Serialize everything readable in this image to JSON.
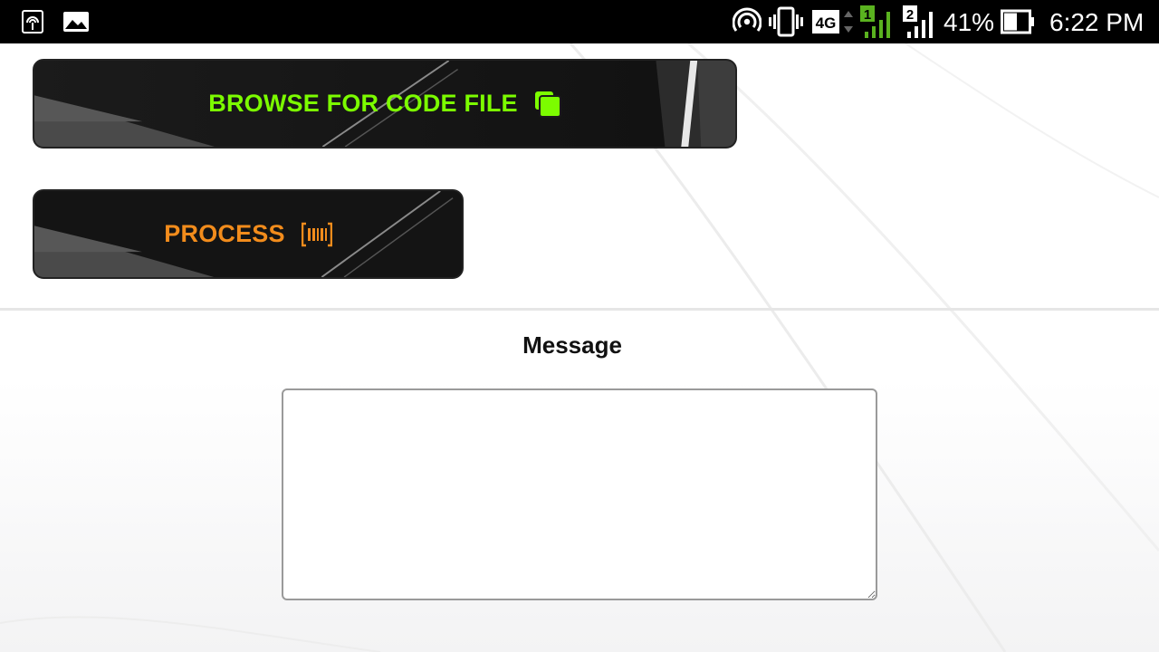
{
  "status_bar": {
    "battery_percent": "41%",
    "time": "6:22 PM",
    "network_type": "4G",
    "sim1_label": "1",
    "sim2_label": "2",
    "icons": [
      "hotspot-icon",
      "gallery-icon",
      "wifi-hotspot-icon",
      "vibrate-icon",
      "network-4g-icon",
      "signal-sim1-icon",
      "signal-sim2-icon",
      "battery-icon"
    ]
  },
  "buttons": {
    "browse_label": "BROWSE FOR CODE FILE",
    "browse_icon": "copy-icon",
    "browse_color": "#7CFC00",
    "process_label": "PROCESS",
    "process_icon": "barcode-icon",
    "process_color": "#F28C1C"
  },
  "message": {
    "title": "Message",
    "value": ""
  }
}
